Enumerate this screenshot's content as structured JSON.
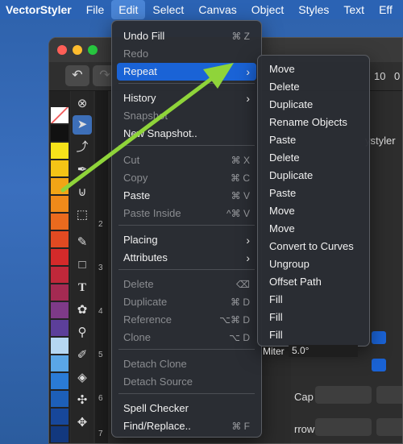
{
  "menubar": {
    "app": "VectorStyler",
    "items": [
      "File",
      "Edit",
      "Select",
      "Canvas",
      "Object",
      "Styles",
      "Text",
      "Eff"
    ]
  },
  "edit_menu": {
    "items": [
      {
        "label": "Undo Fill",
        "shortcut": "⌘ Z",
        "disabled": false
      },
      {
        "label": "Redo",
        "shortcut": "",
        "disabled": true
      },
      {
        "label": "Repeat",
        "shortcut": "",
        "disabled": false,
        "submenu": true,
        "highlighted": true
      },
      {
        "label": "History",
        "shortcut": "",
        "disabled": false,
        "submenu": true
      },
      {
        "label": "Snapshot",
        "shortcut": "",
        "disabled": true
      },
      {
        "label": "New Snapshot..",
        "shortcut": "",
        "disabled": false
      },
      {
        "label": "Cut",
        "shortcut": "⌘ X",
        "disabled": true
      },
      {
        "label": "Copy",
        "shortcut": "⌘ C",
        "disabled": true
      },
      {
        "label": "Paste",
        "shortcut": "⌘ V",
        "disabled": false
      },
      {
        "label": "Paste Inside",
        "shortcut": "^⌘ V",
        "disabled": true
      },
      {
        "label": "Placing",
        "shortcut": "",
        "disabled": false,
        "submenu": true
      },
      {
        "label": "Attributes",
        "shortcut": "",
        "disabled": false,
        "submenu": true
      },
      {
        "label": "Delete",
        "shortcut": "⌫",
        "disabled": true
      },
      {
        "label": "Duplicate",
        "shortcut": "⌘ D",
        "disabled": true
      },
      {
        "label": "Reference",
        "shortcut": "⌥⌘ D",
        "disabled": true
      },
      {
        "label": "Clone",
        "shortcut": "⌥ D",
        "disabled": true
      },
      {
        "label": "Detach Clone",
        "shortcut": "",
        "disabled": true
      },
      {
        "label": "Detach Source",
        "shortcut": "",
        "disabled": true
      },
      {
        "label": "Spell Checker",
        "shortcut": "",
        "disabled": false
      },
      {
        "label": "Find/Replace..",
        "shortcut": "⌘ F",
        "disabled": false
      }
    ]
  },
  "repeat_submenu": {
    "items": [
      "Move",
      "Delete",
      "Duplicate",
      "Rename Objects",
      "Paste",
      "Delete",
      "Duplicate",
      "Paste",
      "Move",
      "Move",
      "Convert to Curves",
      "Ungroup",
      "Offset Path",
      "Fill",
      "Fill",
      "Fill"
    ]
  },
  "panel": {
    "label_styler": "ystyler",
    "miter_label": "Miter",
    "miter_value": "5.0°",
    "cap_label": "Cap",
    "arrow_label": "rrow",
    "value_10": "10",
    "value_0": "0"
  },
  "ruler": [
    "2",
    "3",
    "4",
    "5",
    "6",
    "7",
    "8"
  ],
  "colors": {
    "highlight": "#1a63d6",
    "arrow": "#8fd43a",
    "menubar": "#2b63b4"
  }
}
